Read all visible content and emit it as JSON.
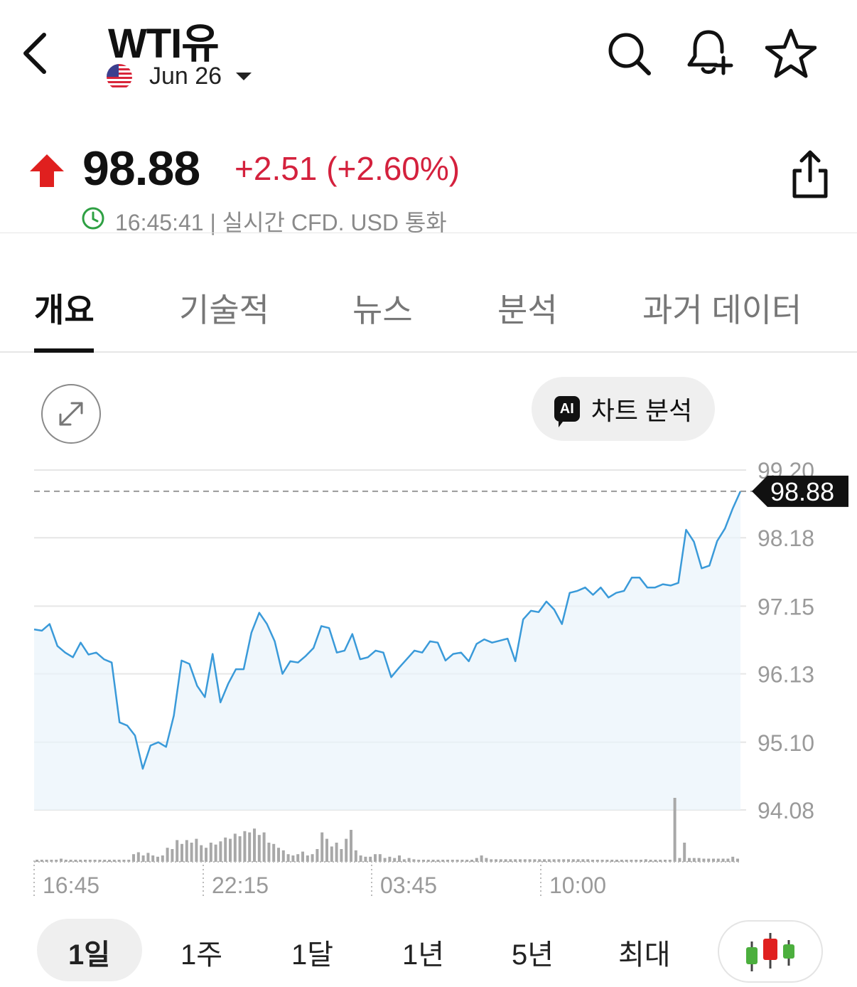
{
  "header": {
    "title": "WTI유",
    "contract": "Jun 26",
    "icons": [
      "back-icon",
      "search-icon",
      "bell-plus-icon",
      "star-icon",
      "us-flag-icon",
      "chevron-down-icon"
    ]
  },
  "quote": {
    "price": "98.88",
    "change": "+2.51 (+2.60%)",
    "meta": "16:45:41 | 실시간 CFD. USD 통화",
    "up_color": "#e0201f",
    "change_color": "#d4213d"
  },
  "tabs": [
    "개요",
    "기술적",
    "뉴스",
    "분석",
    "과거 데이터"
  ],
  "active_tab": 0,
  "chart_actions": {
    "ai_badge": "AI",
    "ai_label": "차트 분석"
  },
  "ranges": [
    "1일",
    "1주",
    "1달",
    "1년",
    "5년",
    "최대"
  ],
  "active_range": 0,
  "colors": {
    "line": "#3a9ad9",
    "fill": "#e9f3fb",
    "current_tag_bg": "#111111"
  },
  "chart_data": {
    "type": "line",
    "x_ticks": [
      "16:45",
      "22:15",
      "03:45",
      "10:00"
    ],
    "y_ticks": [
      99.2,
      98.18,
      97.15,
      96.13,
      95.1,
      94.08
    ],
    "current_value": 98.88,
    "current_label": "98.88",
    "ylim": [
      94.08,
      99.2
    ],
    "grid": true,
    "values": [
      96.8,
      96.78,
      96.88,
      96.55,
      96.45,
      96.38,
      96.6,
      96.42,
      96.45,
      96.35,
      96.3,
      95.4,
      95.35,
      95.2,
      94.7,
      95.05,
      95.1,
      95.03,
      95.5,
      96.33,
      96.28,
      95.95,
      95.78,
      96.43,
      95.7,
      95.98,
      96.2,
      96.2,
      96.75,
      97.05,
      96.88,
      96.62,
      96.13,
      96.32,
      96.3,
      96.4,
      96.52,
      96.85,
      96.82,
      96.45,
      96.48,
      96.73,
      96.35,
      96.38,
      96.48,
      96.45,
      96.08,
      96.22,
      96.35,
      96.48,
      96.45,
      96.62,
      96.6,
      96.33,
      96.43,
      96.45,
      96.32,
      96.58,
      96.65,
      96.6,
      96.63,
      96.66,
      96.32,
      96.95,
      97.08,
      97.06,
      97.22,
      97.1,
      96.88,
      97.35,
      97.38,
      97.43,
      97.32,
      97.43,
      97.28,
      97.35,
      97.38,
      97.58,
      97.58,
      97.43,
      97.43,
      97.48,
      97.46,
      97.5,
      98.3,
      98.12,
      97.72,
      97.76,
      98.13,
      98.32,
      98.62,
      98.88
    ],
    "volume": [
      0.03,
      0.03,
      0.03,
      0.03,
      0.03,
      0.05,
      0.03,
      0.03,
      0.03,
      0.03,
      0.03,
      0.03,
      0.03,
      0.03,
      0.03,
      0.03,
      0.03,
      0.03,
      0.03,
      0.03,
      0.12,
      0.15,
      0.1,
      0.14,
      0.1,
      0.08,
      0.1,
      0.22,
      0.2,
      0.34,
      0.28,
      0.34,
      0.3,
      0.36,
      0.26,
      0.22,
      0.3,
      0.27,
      0.32,
      0.38,
      0.36,
      0.44,
      0.4,
      0.48,
      0.46,
      0.52,
      0.42,
      0.46,
      0.3,
      0.28,
      0.22,
      0.18,
      0.12,
      0.1,
      0.12,
      0.16,
      0.1,
      0.12,
      0.2,
      0.46,
      0.36,
      0.24,
      0.3,
      0.2,
      0.36,
      0.5,
      0.18,
      0.1,
      0.08,
      0.08,
      0.12,
      0.12,
      0.06,
      0.08,
      0.06,
      0.1,
      0.04,
      0.06,
      0.04,
      0.03,
      0.03,
      0.03,
      0.03,
      0.03,
      0.03,
      0.03,
      0.03,
      0.03,
      0.03,
      0.03,
      0.03,
      0.06,
      0.1,
      0.06,
      0.04,
      0.04,
      0.04,
      0.04,
      0.04,
      0.04,
      0.04,
      0.04,
      0.04,
      0.04,
      0.04,
      0.04,
      0.04,
      0.04,
      0.04,
      0.04,
      0.04,
      0.04,
      0.04,
      0.04,
      0.04,
      0.03,
      0.03,
      0.03,
      0.03,
      0.03,
      0.03,
      0.03,
      0.03,
      0.03,
      0.03,
      0.03,
      0.04,
      0.03,
      0.03,
      0.03,
      0.03,
      0.03,
      1.0,
      0.06,
      0.3,
      0.06,
      0.06,
      0.06,
      0.05,
      0.05,
      0.05,
      0.05,
      0.05,
      0.05,
      0.08,
      0.05
    ]
  }
}
